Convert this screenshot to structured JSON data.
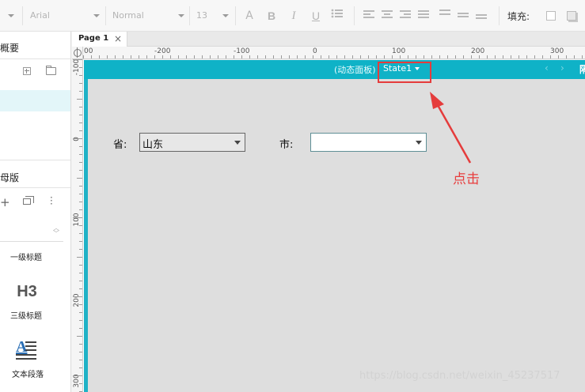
{
  "toolbar": {
    "font_family": "Arial",
    "font_style": "Normal",
    "font_size": "13",
    "text_color_glyph": "A",
    "bold_glyph": "B",
    "italic_glyph": "I",
    "underline_glyph": "U",
    "fill_label": "填充:"
  },
  "left_panel": {
    "outline_title": "概要",
    "masters_title": "母版",
    "widgets": [
      {
        "label": "一级标题"
      },
      {
        "label": "三级标题",
        "glyph": "H3"
      },
      {
        "label": "文本段落",
        "glyph": "A"
      }
    ]
  },
  "tabs": [
    {
      "label": "Page 1",
      "close": "×"
    }
  ],
  "ruler": {
    "horizontal_labels": [
      "00",
      "-200",
      "-100",
      "0",
      "100",
      "200",
      "300"
    ],
    "vertical_labels": [
      "-100",
      "0",
      "100",
      "200",
      "300"
    ]
  },
  "dynamic_panel": {
    "name": "(动态面板)",
    "state": "State1",
    "prev_arrow": "‹",
    "next_arrow": "›",
    "overflow_glyph": "隔"
  },
  "form": {
    "province_label": "省:",
    "province_value": "山东",
    "city_label": "市:",
    "city_value": ""
  },
  "annotation": {
    "text": "点击"
  },
  "watermark": "https://blog.csdn.net/weixin_45237517",
  "colors": {
    "panel_header": "#0fb2c7",
    "annotation_red": "#e53c3c",
    "canvas_gray": "#dedede"
  }
}
